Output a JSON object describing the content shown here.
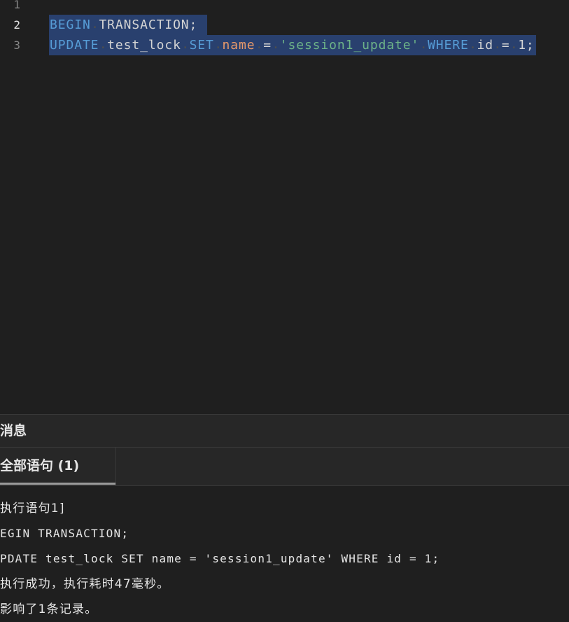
{
  "editor": {
    "lines": [
      {
        "number": "1",
        "tokens": []
      },
      {
        "number": "2",
        "tokens": [
          "BEGIN",
          " ",
          "TRANSACTION;"
        ]
      },
      {
        "number": "3",
        "tokens": [
          "UPDATE",
          " ",
          "test_lock",
          " ",
          "SET",
          " ",
          "name",
          " ",
          "=",
          " ",
          "'session1_update'",
          " ",
          "WHERE",
          " ",
          "id",
          " ",
          "=",
          " ",
          "1;"
        ]
      }
    ]
  },
  "panel": {
    "title": "消息",
    "tabs": [
      {
        "label": "全部语句 (1)"
      }
    ]
  },
  "output": {
    "lines": [
      "执行语句1]",
      "EGIN TRANSACTION;",
      "PDATE test_lock SET name = 'session1_update' WHERE id = 1;",
      "执行成功，执行耗时47毫秒。",
      "影响了1条记录。"
    ]
  },
  "colors": {
    "editor_bg": "#1f1f1f",
    "panel_bg": "#272727",
    "border": "#3a3a3a",
    "selection": "#29406e",
    "keyword": "#569cd6",
    "identifier": "#d4d4d4",
    "column": "#e8996a",
    "string": "#6db388",
    "whitespace": "#4e4e4e",
    "text": "#e6e6e6",
    "line_number": "#858585",
    "line_number_active": "#e6e6e6",
    "tab_underline": "#9a9a9a"
  }
}
